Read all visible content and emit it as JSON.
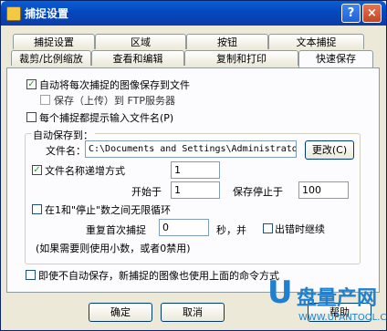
{
  "window": {
    "title": "捕捉设置",
    "help_label": "?",
    "close_label": "×"
  },
  "tabs_row1": [
    "捕捉设置",
    "区域",
    "按钮",
    "文本捕捉"
  ],
  "tabs_row2": [
    "裁剪/比例缩放",
    "查看和编辑",
    "复制和打印",
    "快速保存"
  ],
  "options": {
    "auto_save": {
      "label": "自动将每次捕捉的图像保存到文件",
      "checked": true
    },
    "ftp_save": {
      "label": "保存（上传）到 FTP服务器",
      "checked": false
    },
    "prompt_name": {
      "label": "每个捕捉都提示输入文件名(P)",
      "checked": false
    }
  },
  "autosave_group": {
    "title": "自动保存到：",
    "filename_label": "文件名：",
    "filename_value": "C:\\Documents and Settings\\Administrato",
    "change_button": "更改(C)",
    "increment_label": "文件名称递增方式",
    "increment_checked": true,
    "increment_value": "1",
    "start_label": "开始于",
    "start_value": "1",
    "stop_label": "保存停止于",
    "stop_value": "100",
    "loop_label": "在1和\"停止\"数之间无限循环",
    "loop_checked": false,
    "repeat_label": "重复首次捕捉",
    "repeat_value": "0",
    "seconds_label": "秒，并",
    "continue_label": "出错时继续",
    "continue_checked": false,
    "hint": "(如果需要则使用小数，或者0禁用)"
  },
  "footer_option": {
    "label": "即使不自动保存，新捕捉的图像也使用上面的命令方式",
    "checked": false
  },
  "buttons": {
    "ok": "确定",
    "cancel": "取消",
    "help": "帮助"
  },
  "watermark": {
    "logo": "U",
    "text": "盘量产网",
    "url": "WWW.UPANTOOL.COM"
  }
}
